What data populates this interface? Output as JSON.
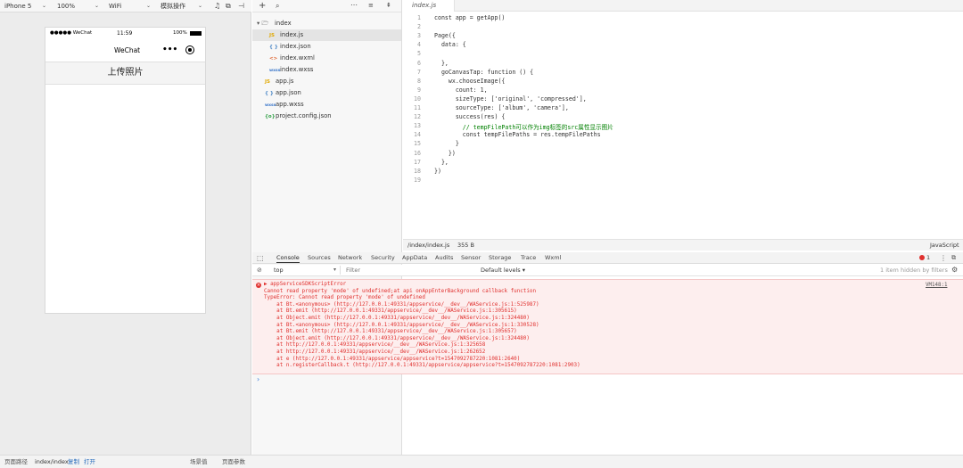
{
  "toolbar": {
    "device": "iPhone 5",
    "zoom": "100%",
    "network": "WiFi",
    "mode": "模拟操作"
  },
  "phone": {
    "signal": "●●●●● WeChat",
    "time": "11:59",
    "battery": "100%",
    "nav_title": "WeChat",
    "more": "•••",
    "button_label": "上传照片"
  },
  "explorer": {
    "items": [
      {
        "icon": "▾ 🗁",
        "label": "index"
      },
      {
        "icon": "JS",
        "label": "index.js"
      },
      {
        "icon": "{ }",
        "label": "index.json"
      },
      {
        "icon": "<>",
        "label": "index.wxml"
      },
      {
        "icon": "wxss",
        "label": "index.wxss"
      },
      {
        "icon": "JS",
        "label": "app.js"
      },
      {
        "icon": "{ }",
        "label": "app.json"
      },
      {
        "icon": "wxss",
        "label": "app.wxss"
      },
      {
        "icon": "{o}",
        "label": "project.config.json"
      }
    ]
  },
  "editor": {
    "tab": "index.js",
    "path": "/index/index.js",
    "size": "355 B",
    "language": "JavaScript",
    "lines": [
      "const app = getApp()",
      "",
      "Page({",
      "  data: {",
      "",
      "  },",
      "  goCanvasTap: function () {",
      "    wx.chooseImage({",
      "      count: 1,",
      "      sizeType: ['original', 'compressed'],",
      "      sourceType: ['album', 'camera'],",
      "      success(res) {",
      "        // tempFilePath可以作为img标签的src属性显示图片",
      "        const tempFilePaths = res.tempFilePaths",
      "      }",
      "    })",
      "  },",
      "})",
      ""
    ]
  },
  "devtools": {
    "tabs": [
      "Console",
      "Sources",
      "Network",
      "Security",
      "AppData",
      "Audits",
      "Sensor",
      "Storage",
      "Trace",
      "Wxml"
    ],
    "error_count": "1",
    "context": "top",
    "filter_placeholder": "Filter",
    "levels": "Default levels ▾",
    "hidden": "1 item hidden by filters",
    "source_ref": "VM148:1",
    "error_lines": [
      "▶ appServiceSDKScriptError",
      "Cannot read property 'mode' of undefined;at api onAppEnterBackground callback function",
      "TypeError: Cannot read property 'mode' of undefined",
      "    at Bt.<anonymous> (http://127.0.0.1:49331/appservice/__dev__/WAService.js:1:525987)",
      "    at Bt.emit (http://127.0.0.1:49331/appservice/__dev__/WAService.js:1:305615)",
      "    at Object.emit (http://127.0.0.1:49331/appservice/__dev__/WAService.js:1:324480)",
      "    at Bt.<anonymous> (http://127.0.0.1:49331/appservice/__dev__/WAService.js:1:330528)",
      "    at Bt.emit (http://127.0.0.1:49331/appservice/__dev__/WAService.js:1:305657)",
      "    at Object.emit (http://127.0.0.1:49331/appservice/__dev__/WAService.js:1:324480)",
      "    at http://127.0.0.1:49331/appservice/__dev__/WAService.js:1:325658",
      "    at http://127.0.0.1:49331/appservice/__dev__/WAService.js:1:262652",
      "    at e (http://127.0.0.1:49331/appservice/appservice?t=1547092787220:1081:2640)",
      "    at n.registerCallback.t (http://127.0.0.1:49331/appservice/appservice?t=1547092787220:1081:2903)"
    ],
    "prompt": "›"
  },
  "bottom": {
    "path_label": "页面路径",
    "path_value": "index/index",
    "copy": "复制",
    "open": "打开",
    "scene": "场景值",
    "params": "页面参数"
  }
}
